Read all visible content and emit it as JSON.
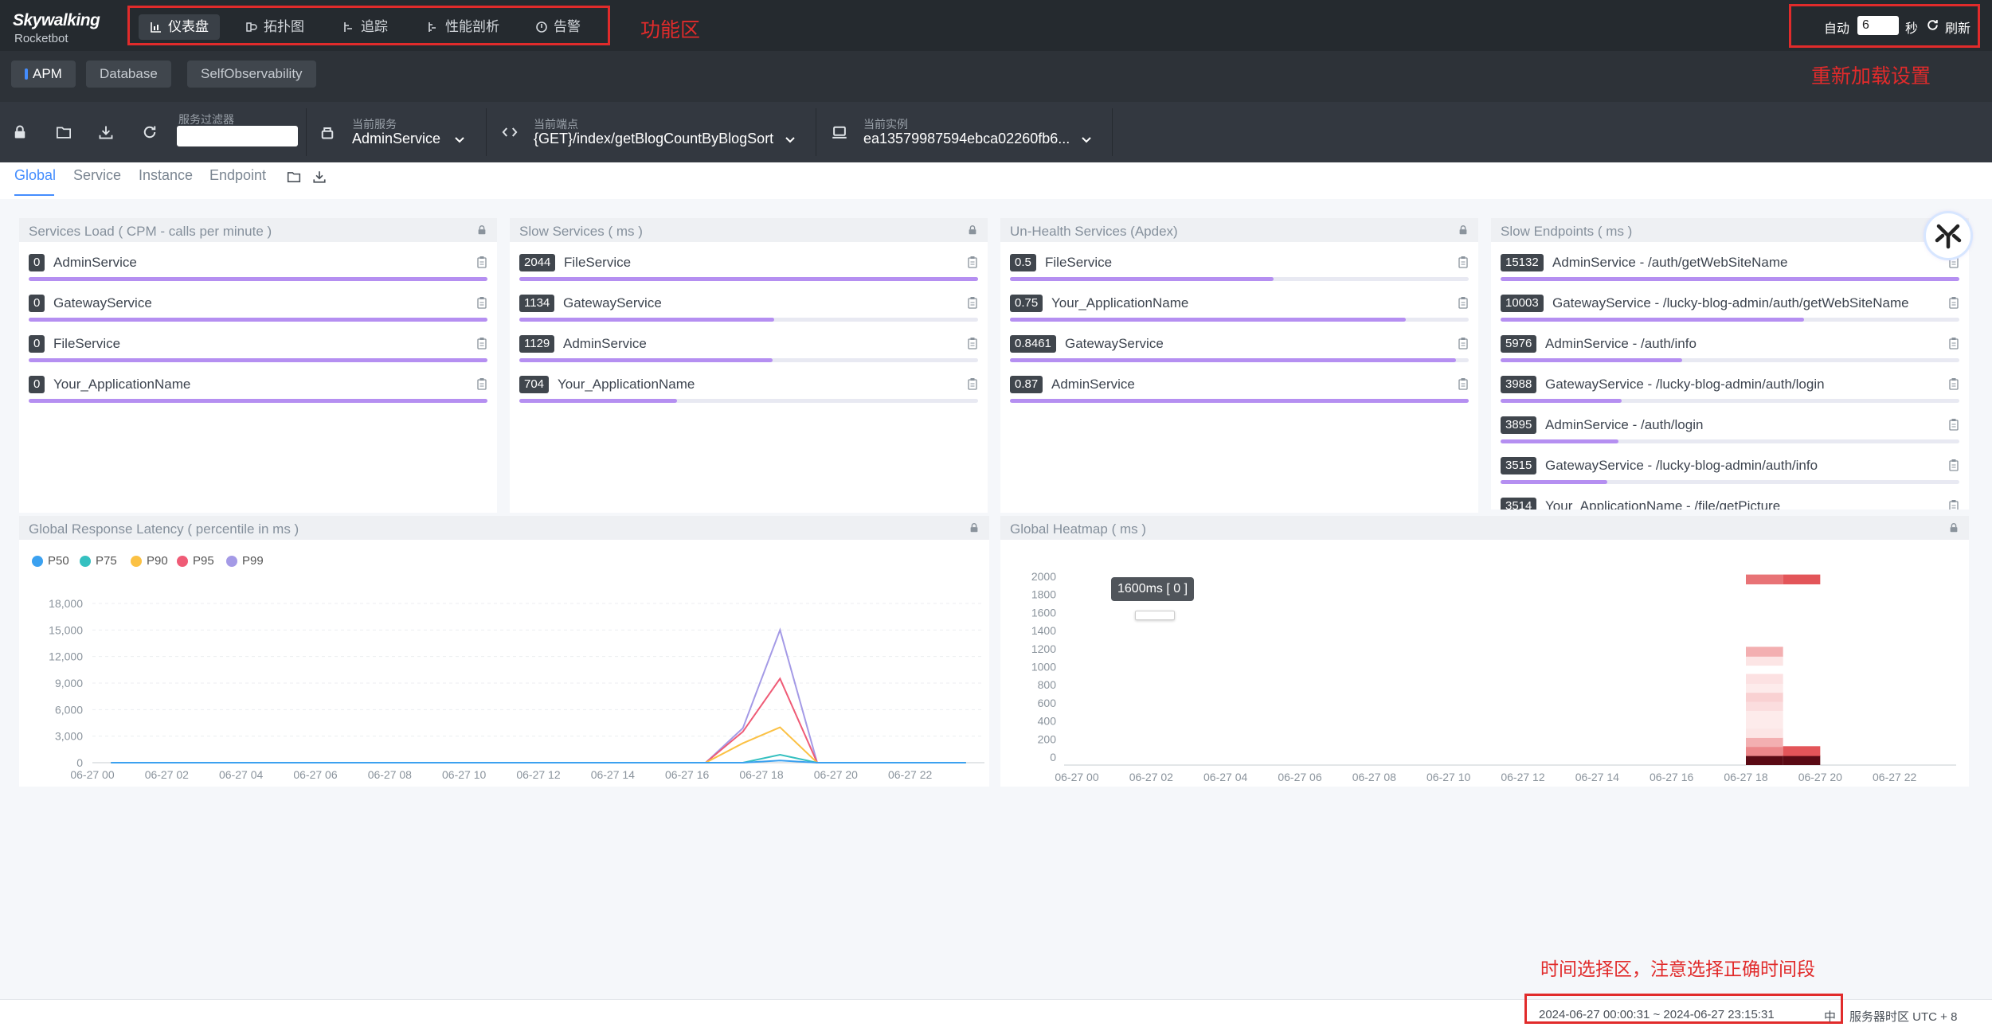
{
  "app": {
    "logo": "Skywalking",
    "logo_sub": "Rocketbot"
  },
  "nav": [
    {
      "label": "仪表盘",
      "icon": "dashboard-icon",
      "active": true
    },
    {
      "label": "拓扑图",
      "icon": "topology-icon",
      "active": false
    },
    {
      "label": "追踪",
      "icon": "trace-icon",
      "active": false
    },
    {
      "label": "性能剖析",
      "icon": "profile-icon",
      "active": false
    },
    {
      "label": "告警",
      "icon": "alarm-icon",
      "active": false
    }
  ],
  "annotations": {
    "function_area": "功能区",
    "reload_settings": "重新加载设置",
    "time_select": "时间选择区，注意选择正确时间段"
  },
  "reload": {
    "auto_label": "自动",
    "interval": "6",
    "unit": "秒",
    "refresh_label": "刷新"
  },
  "layers": [
    {
      "label": "APM",
      "active": true
    },
    {
      "label": "Database",
      "active": false
    },
    {
      "label": "SelfObservability",
      "active": false
    }
  ],
  "selectors": {
    "filter_label": "服务过滤器",
    "service_label": "当前服务",
    "service_value": "AdminService",
    "endpoint_label": "当前端点",
    "endpoint_value": "{GET}/index/getBlogCountByBlogSort",
    "instance_label": "当前实例",
    "instance_value": "ea13579987594ebca02260fb6..."
  },
  "dashboard_tabs": [
    {
      "label": "Global",
      "active": true
    },
    {
      "label": "Service",
      "active": false
    },
    {
      "label": "Instance",
      "active": false
    },
    {
      "label": "Endpoint",
      "active": false
    }
  ],
  "panels": {
    "services_load": {
      "title": "Services Load ( CPM - calls per minute )",
      "items": [
        {
          "value": "0",
          "name": "AdminService",
          "ratio": 1.0
        },
        {
          "value": "0",
          "name": "GatewayService",
          "ratio": 1.0
        },
        {
          "value": "0",
          "name": "FileService",
          "ratio": 1.0
        },
        {
          "value": "0",
          "name": "Your_ApplicationName",
          "ratio": 1.0
        }
      ]
    },
    "slow_services": {
      "title": "Slow Services ( ms )",
      "items": [
        {
          "value": "2044",
          "name": "FileService",
          "ratio": 1.0
        },
        {
          "value": "1134",
          "name": "GatewayService",
          "ratio": 0.555
        },
        {
          "value": "1129",
          "name": "AdminService",
          "ratio": 0.552
        },
        {
          "value": "704",
          "name": "Your_ApplicationName",
          "ratio": 0.344
        }
      ]
    },
    "unhealth_services": {
      "title": "Un-Health Services (Apdex)",
      "items": [
        {
          "value": "0.5",
          "name": "FileService",
          "ratio": 0.575
        },
        {
          "value": "0.75",
          "name": "Your_ApplicationName",
          "ratio": 0.862
        },
        {
          "value": "0.8461",
          "name": "GatewayService",
          "ratio": 0.973
        },
        {
          "value": "0.87",
          "name": "AdminService",
          "ratio": 1.0
        }
      ]
    },
    "slow_endpoints": {
      "title": "Slow Endpoints ( ms )",
      "items": [
        {
          "value": "15132",
          "name": "AdminService - /auth/getWebSiteName",
          "ratio": 1.0
        },
        {
          "value": "10003",
          "name": "GatewayService - /lucky-blog-admin/auth/getWebSiteName",
          "ratio": 0.661
        },
        {
          "value": "5976",
          "name": "AdminService - /auth/info",
          "ratio": 0.395
        },
        {
          "value": "3988",
          "name": "GatewayService - /lucky-blog-admin/auth/login",
          "ratio": 0.264
        },
        {
          "value": "3895",
          "name": "AdminService - /auth/login",
          "ratio": 0.257
        },
        {
          "value": "3515",
          "name": "GatewayService - /lucky-blog-admin/auth/info",
          "ratio": 0.232
        },
        {
          "value": "3514",
          "name": "Your_ApplicationName - /file/getPicture",
          "ratio": 0.232
        }
      ]
    },
    "latency": {
      "title": "Global Response Latency ( percentile in ms )"
    },
    "heatmap": {
      "title": "Global Heatmap ( ms )",
      "tooltip": "1600ms [ 0 ]"
    }
  },
  "chart_data": [
    {
      "type": "line",
      "title": "Global Response Latency ( percentile in ms )",
      "x": [
        "06-27 00",
        "06-27 01",
        "06-27 02",
        "06-27 03",
        "06-27 04",
        "06-27 05",
        "06-27 06",
        "06-27 07",
        "06-27 08",
        "06-27 09",
        "06-27 10",
        "06-27 11",
        "06-27 12",
        "06-27 13",
        "06-27 14",
        "06-27 15",
        "06-27 16",
        "06-27 17",
        "06-27 18",
        "06-27 19",
        "06-27 20",
        "06-27 21",
        "06-27 22",
        "06-27 23"
      ],
      "x_ticks": [
        "06-27 00",
        "06-27 02",
        "06-27 04",
        "06-27 06",
        "06-27 08",
        "06-27 10",
        "06-27 12",
        "06-27 14",
        "06-27 16",
        "06-27 18",
        "06-27 20",
        "06-27 22"
      ],
      "y_ticks": [
        "0",
        "3,000",
        "6,000",
        "9,000",
        "12,000",
        "15,000",
        "18,000"
      ],
      "ylim": [
        0,
        18000
      ],
      "grid": true,
      "legend_position": "top-left",
      "series": [
        {
          "name": "P50",
          "color": "#3ba1f0",
          "values": [
            0,
            0,
            0,
            0,
            0,
            0,
            0,
            0,
            0,
            0,
            0,
            0,
            0,
            0,
            0,
            0,
            0,
            0,
            250,
            0,
            0,
            0,
            0,
            0
          ]
        },
        {
          "name": "P75",
          "color": "#35c0c0",
          "values": [
            0,
            0,
            0,
            0,
            0,
            0,
            0,
            0,
            0,
            0,
            0,
            0,
            0,
            0,
            0,
            0,
            0,
            0,
            900,
            0,
            0,
            0,
            0,
            0
          ]
        },
        {
          "name": "P90",
          "color": "#fbc144",
          "values": [
            0,
            0,
            0,
            0,
            0,
            0,
            0,
            0,
            0,
            0,
            0,
            0,
            0,
            0,
            0,
            0,
            0,
            2200,
            4000,
            0,
            0,
            0,
            0,
            0
          ]
        },
        {
          "name": "P95",
          "color": "#ef5b76",
          "values": [
            0,
            0,
            0,
            0,
            0,
            0,
            0,
            0,
            0,
            0,
            0,
            0,
            0,
            0,
            0,
            0,
            0,
            3500,
            9500,
            0,
            0,
            0,
            0,
            0
          ]
        },
        {
          "name": "P99",
          "color": "#a49ae6",
          "values": [
            0,
            0,
            0,
            0,
            0,
            0,
            0,
            0,
            0,
            0,
            0,
            0,
            0,
            0,
            0,
            0,
            0,
            3900,
            15000,
            0,
            0,
            0,
            0,
            0
          ]
        }
      ]
    },
    {
      "type": "heatmap",
      "title": "Global Heatmap ( ms )",
      "x_ticks": [
        "06-27 00",
        "06-27 02",
        "06-27 04",
        "06-27 06",
        "06-27 08",
        "06-27 10",
        "06-27 12",
        "06-27 14",
        "06-27 16",
        "06-27 18",
        "06-27 20",
        "06-27 22"
      ],
      "y_ticks": [
        "0",
        "200",
        "400",
        "600",
        "800",
        "1000",
        "1200",
        "1400",
        "1600",
        "1800",
        "2000"
      ],
      "ylim": [
        0,
        2000
      ],
      "cells": [
        {
          "hour": 18,
          "ms": 0,
          "level": 1.0
        },
        {
          "hour": 18,
          "ms": 100,
          "level": 0.55
        },
        {
          "hour": 18,
          "ms": 200,
          "level": 0.35
        },
        {
          "hour": 18,
          "ms": 300,
          "level": 0.08
        },
        {
          "hour": 18,
          "ms": 400,
          "level": 0.05
        },
        {
          "hour": 18,
          "ms": 500,
          "level": 0.05
        },
        {
          "hour": 18,
          "ms": 600,
          "level": 0.12
        },
        {
          "hour": 18,
          "ms": 700,
          "level": 0.18
        },
        {
          "hour": 18,
          "ms": 800,
          "level": 0.05
        },
        {
          "hour": 18,
          "ms": 900,
          "level": 0.1
        },
        {
          "hour": 18,
          "ms": 1100,
          "level": 0.08
        },
        {
          "hour": 18,
          "ms": 1200,
          "level": 0.35
        },
        {
          "hour": 18,
          "ms": 2000,
          "level": 0.65
        },
        {
          "hour": 19,
          "ms": 0,
          "level": 0.95
        },
        {
          "hour": 19,
          "ms": 100,
          "level": 0.8
        },
        {
          "hour": 19,
          "ms": 2000,
          "level": 0.8
        }
      ]
    }
  ],
  "footer": {
    "time_range": "2024-06-27 00:00:31 ~ 2024-06-27 23:15:31",
    "lang": "中",
    "timezone": "服务器时区 UTC + 8"
  }
}
